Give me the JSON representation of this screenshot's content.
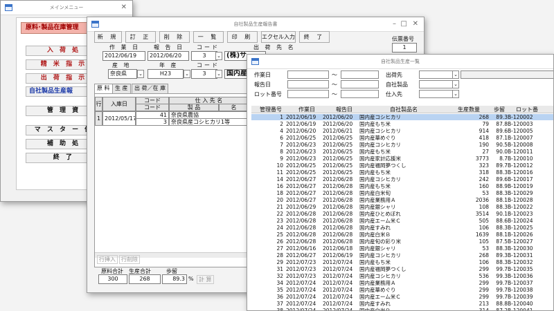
{
  "menu": {
    "title": "メインメニュー",
    "close": "✕",
    "header": "原料･製品在庫管理",
    "buttons": [
      "入 荷 処",
      "精 米 指 示",
      "出 荷 指 示",
      "自社製品生産報",
      "管 理 資",
      "マ ス タ ー 保",
      "補 助 処",
      "終 了"
    ]
  },
  "report": {
    "title": "自社製品生産報告書",
    "controls": [
      "–",
      "□",
      "✕"
    ],
    "toolbar": [
      "新 規",
      "訂 正",
      "削 除",
      "一 覧",
      "印 刷",
      "エクセル入力",
      "終 了"
    ],
    "denpyo_label": "伝票番号",
    "denpyo_value": "1",
    "labels": {
      "sagyobi": "作 業 日",
      "hokokubi": "報 告 日",
      "code": "コード",
      "shukkasaki": "出 荷 先 名",
      "sanchi": "産 地",
      "nendo": "年 産",
      "code2": "コード"
    },
    "values": {
      "sagyobi": "2012/06/19",
      "hokokubi": "2012/06/20",
      "code": "3",
      "shukkasaki": "(株)サ",
      "sanchi": "奈良県",
      "nendo": "H23",
      "code2": "3",
      "product": "国内産"
    },
    "tabs": [
      "原 料",
      "生 産",
      "出 荷／在 庫"
    ],
    "grid": {
      "row_no_header": "行",
      "date_header": "入庫日",
      "code_header": "コード",
      "supplier_header": "仕 入 先 名",
      "code2_header": "コード",
      "product_header": "製 品",
      "name_header": "名",
      "row_no": "1",
      "date": "2012/05/17",
      "code1": "41",
      "supplier": "奈良県農協",
      "code2": "3",
      "product": "奈良県産コシヒカリ1等"
    },
    "row_buttons": [
      "行挿入",
      "行削除"
    ],
    "summary_labels": {
      "total": "原料合計",
      "prod_total": "生産合計",
      "yield": "歩留"
    },
    "summary_values": {
      "total": "300",
      "prod_total": "268",
      "yield": "89.3",
      "yield_unit": "%",
      "calc": "計 算"
    }
  },
  "list": {
    "title": "自社製品生産一覧",
    "filters": {
      "sagyobi": "作業日",
      "hokokubi": "報告日",
      "lot": "ロット番号",
      "tilde": "～",
      "shukkasaki": "出荷先",
      "product": "自社製品",
      "shiiresaki": "仕入先"
    },
    "columns": [
      "管理番号",
      "作業日",
      "報告日",
      "自社製品名",
      "生産数量",
      "歩留",
      "ロット番"
    ],
    "rows": [
      [
        "1",
        "2012/06/19",
        "2012/06/20",
        "国内産コシヒカリ",
        "268",
        "89.3",
        "B-120002"
      ],
      [
        "2",
        "2012/06/19",
        "2012/06/20",
        "国内産もち米",
        "79",
        "87.8",
        "B-120003"
      ],
      [
        "4",
        "2012/06/20",
        "2012/06/21",
        "国内産コシヒカリ",
        "914",
        "89.6",
        "B-120005"
      ],
      [
        "6",
        "2012/06/25",
        "2012/06/25",
        "国内産華めぐり",
        "418",
        "87.1",
        "B-120007"
      ],
      [
        "7",
        "2012/06/23",
        "2012/06/25",
        "国内産コシヒカリ",
        "190",
        "90.5",
        "B-120008"
      ],
      [
        "8",
        "2012/06/23",
        "2012/06/25",
        "国内産もち米",
        "27",
        "90.0",
        "B-120011"
      ],
      [
        "9",
        "2012/06/23",
        "2012/06/25",
        "国内産家計応援米",
        "3773",
        "8.7",
        "B-120010"
      ],
      [
        "10",
        "2012/06/25",
        "2012/06/25",
        "国内産福岡夢つくし",
        "323",
        "89.7",
        "B-120012"
      ],
      [
        "11",
        "2012/06/25",
        "2012/06/25",
        "国内産もち米",
        "318",
        "88.3",
        "B-120016"
      ],
      [
        "14",
        "2012/06/27",
        "2012/06/28",
        "国内産コシヒカリ",
        "242",
        "89.6",
        "B-120017"
      ],
      [
        "16",
        "2012/06/27",
        "2012/06/28",
        "国内産もち米",
        "160",
        "88.9",
        "B-120019"
      ],
      [
        "18",
        "2012/06/27",
        "2012/06/28",
        "国内産白米旬",
        "53",
        "88.3",
        "B-120029"
      ],
      [
        "20",
        "2012/06/27",
        "2012/06/28",
        "国内産業務用Ａ",
        "2036",
        "88.1",
        "B-120028"
      ],
      [
        "21",
        "2012/06/29",
        "2012/06/28",
        "国内産銀シャリ",
        "108",
        "88.3",
        "B-120022"
      ],
      [
        "22",
        "2012/06/28",
        "2012/06/28",
        "国内産ひとめぼれ",
        "3514",
        "90.1",
        "B-120023"
      ],
      [
        "23",
        "2012/06/28",
        "2012/06/28",
        "国内産エーム米Ｃ",
        "505",
        "88.6",
        "B-120024"
      ],
      [
        "24",
        "2012/06/28",
        "2012/06/28",
        "国内産すみれ",
        "106",
        "88.3",
        "B-120025"
      ],
      [
        "25",
        "2012/06/28",
        "2012/06/28",
        "国内産白米Ｂ",
        "1639",
        "88.1",
        "B-120026"
      ],
      [
        "26",
        "2012/06/28",
        "2012/06/28",
        "国内産旬の彩り米",
        "105",
        "87.5",
        "B-120027"
      ],
      [
        "27",
        "2012/06/16",
        "2012/06/18",
        "国内産銀シャリ",
        "53",
        "88.3",
        "B-120030"
      ],
      [
        "28",
        "2012/06/27",
        "2012/06/19",
        "国内産コシヒカリ",
        "268",
        "89.3",
        "B-120031"
      ],
      [
        "29",
        "2012/07/23",
        "2012/07/24",
        "国内産もち米",
        "106",
        "88.3",
        "B-120032"
      ],
      [
        "31",
        "2012/07/23",
        "2012/07/24",
        "国内産福岡夢つくし",
        "299",
        "99.7",
        "B-120035"
      ],
      [
        "32",
        "2012/07/23",
        "2012/07/24",
        "国内産コシヒカリ",
        "536",
        "99.3",
        "B-120036"
      ],
      [
        "34",
        "2012/07/24",
        "2012/07/24",
        "国内産業務用Ａ",
        "299",
        "99.7",
        "B-120037"
      ],
      [
        "35",
        "2012/07/24",
        "2012/07/24",
        "国内産華めぐり",
        "299",
        "99.7",
        "B-120038"
      ],
      [
        "36",
        "2012/07/24",
        "2012/07/24",
        "国内産エーム米Ｃ",
        "299",
        "99.7",
        "B-120039"
      ],
      [
        "37",
        "2012/07/24",
        "2012/07/24",
        "国内産すみれ",
        "213",
        "88.8",
        "B-120040"
      ],
      [
        "38",
        "2012/07/24",
        "2012/07/24",
        "国内産白米Ｂ",
        "314",
        "87.2",
        "B-120041"
      ],
      [
        "39",
        "2012/07/24",
        "2012/07/24",
        "国内産旬の彩り米",
        "975",
        "88.1",
        "B-120042"
      ]
    ]
  },
  "colors": {
    "menu_header_bg": "#f4b3ab",
    "menu_header_text": "#a00000",
    "highlight_text": "#1c3aa8",
    "selected_row": "#b9d3f2"
  }
}
